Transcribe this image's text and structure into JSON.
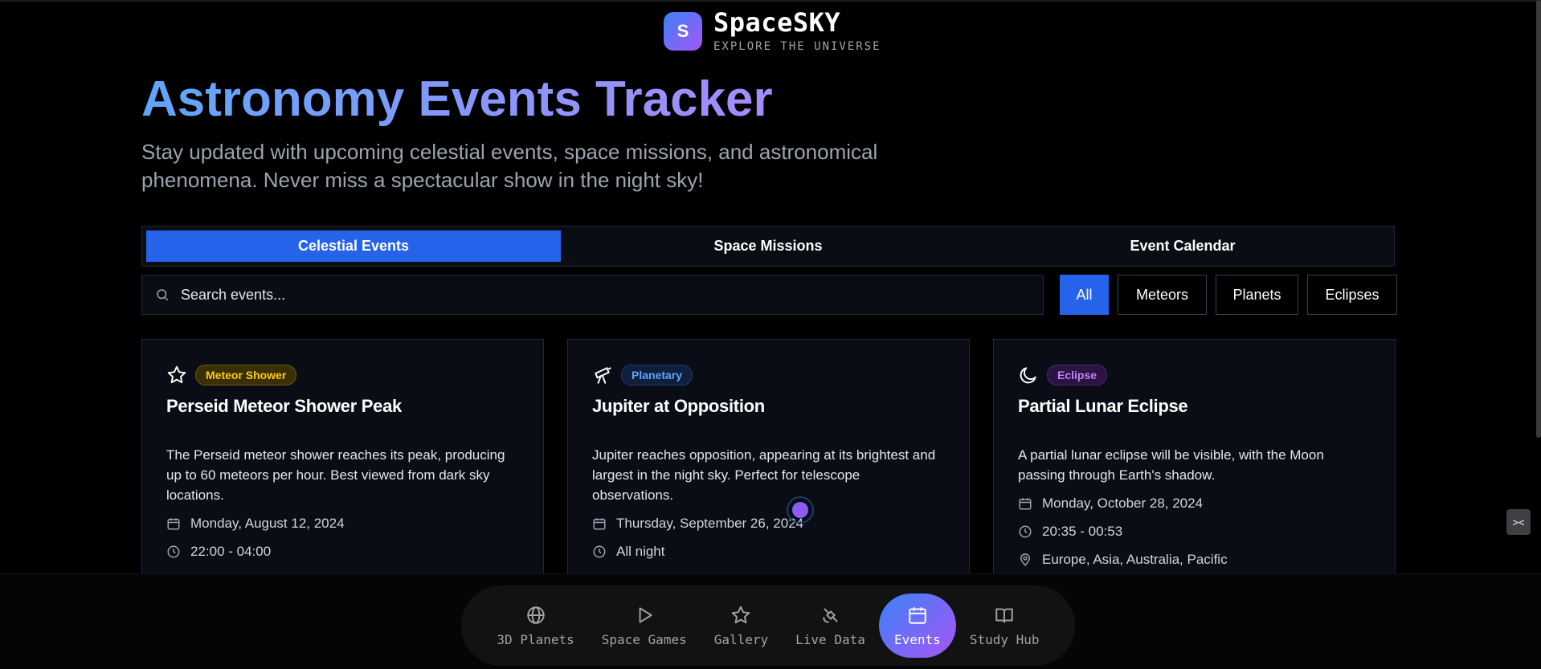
{
  "brand": {
    "logo_letter": "S",
    "name": "SpaceSKY",
    "tagline": "EXPLORE THE UNIVERSE"
  },
  "hero": {
    "title": "Astronomy Events Tracker",
    "subtitle": "Stay updated with upcoming celestial events, space missions, and astronomical phenomena. Never miss a spectacular show in the night sky!"
  },
  "tabs": [
    {
      "label": "Celestial Events",
      "active": true
    },
    {
      "label": "Space Missions",
      "active": false
    },
    {
      "label": "Event Calendar",
      "active": false
    }
  ],
  "search": {
    "placeholder": "Search events..."
  },
  "filters": [
    {
      "label": "All",
      "active": true
    },
    {
      "label": "Meteors",
      "active": false
    },
    {
      "label": "Planets",
      "active": false
    },
    {
      "label": "Eclipses",
      "active": false
    }
  ],
  "cards": [
    {
      "icon": "star-icon",
      "badge": "Meteor Shower",
      "title": "Perseid Meteor Shower Peak",
      "description": "The Perseid meteor shower reaches its peak, producing up to 60 meteors per hour. Best viewed from dark sky locations.",
      "date": "Monday, August 12, 2024",
      "time": "22:00 - 04:00"
    },
    {
      "icon": "telescope-icon",
      "badge": "Planetary",
      "title": "Jupiter at Opposition",
      "description": "Jupiter reaches opposition, appearing at its brightest and largest in the night sky. Perfect for telescope observations.",
      "date": "Thursday, September 26, 2024",
      "time": "All night"
    },
    {
      "icon": "moon-icon",
      "badge": "Eclipse",
      "title": "Partial Lunar Eclipse",
      "description": "A partial lunar eclipse will be visible, with the Moon passing through Earth's shadow.",
      "date": "Monday, October 28, 2024",
      "time": "20:35 - 00:53",
      "location": "Europe, Asia, Australia, Pacific"
    }
  ],
  "dock": [
    {
      "label": "3D Planets",
      "icon": "globe-icon",
      "active": false
    },
    {
      "label": "Space Games",
      "icon": "play-icon",
      "active": false
    },
    {
      "label": "Gallery",
      "icon": "star-icon",
      "active": false
    },
    {
      "label": "Live Data",
      "icon": "satellite-icon",
      "active": false
    },
    {
      "label": "Events",
      "icon": "calendar-icon",
      "active": true
    },
    {
      "label": "Study Hub",
      "icon": "book-icon",
      "active": false
    }
  ],
  "colors": {
    "accent": "#2563eb",
    "gradient_start": "#3b82f6",
    "gradient_end": "#a855f7",
    "background": "#000000"
  }
}
